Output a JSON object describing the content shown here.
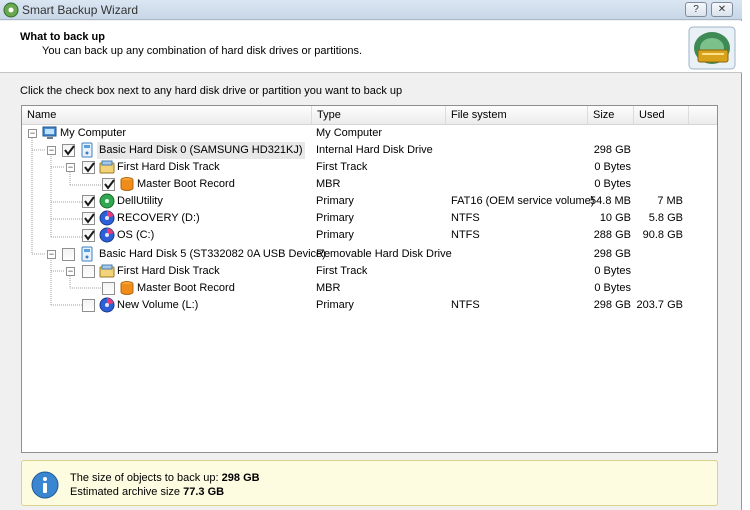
{
  "window": {
    "title": "Smart Backup Wizard",
    "help_label": "?",
    "close_label": "✕"
  },
  "header": {
    "title": "What to back up",
    "subtitle": "You can back up any combination of hard disk drives or partitions."
  },
  "instruction": "Click the check box next to any hard disk drive or partition you want to back up",
  "table": {
    "columns": [
      "Name",
      "Type",
      "File system",
      "Size",
      "Used"
    ],
    "rows": [
      {
        "name": "My Computer",
        "type": "My Computer",
        "fs": "",
        "size": "",
        "used": "",
        "checked": null,
        "icon": "computer-icon"
      },
      {
        "name": "Basic Hard Disk 0 (SAMSUNG HD321KJ)",
        "type": "Internal Hard Disk Drive",
        "fs": "",
        "size": "298 GB",
        "used": "",
        "checked": true,
        "icon": "hard-disk-icon"
      },
      {
        "name": "First Hard Disk Track",
        "type": "First Track",
        "fs": "",
        "size": "0 Bytes",
        "used": "",
        "checked": true,
        "icon": "track-icon"
      },
      {
        "name": "Master Boot Record",
        "type": "MBR",
        "fs": "",
        "size": "0 Bytes",
        "used": "",
        "checked": true,
        "icon": "mbr-icon"
      },
      {
        "name": "DellUtility",
        "type": "Primary",
        "fs": "FAT16 (OEM service volume)",
        "size": "54.8 MB",
        "used": "7 MB",
        "checked": true,
        "icon": "partition-icon"
      },
      {
        "name": "RECOVERY (D:)",
        "type": "Primary",
        "fs": "NTFS",
        "size": "10 GB",
        "used": "5.8 GB",
        "checked": true,
        "icon": "partition-icon"
      },
      {
        "name": "OS (C:)",
        "type": "Primary",
        "fs": "NTFS",
        "size": "288 GB",
        "used": "90.8 GB",
        "checked": true,
        "icon": "partition-icon"
      },
      {
        "name": "Basic Hard Disk 5 (ST332082 0A USB Device)",
        "type": "Removable Hard Disk Drive",
        "fs": "",
        "size": "298 GB",
        "used": "",
        "checked": false,
        "icon": "hard-disk-icon"
      },
      {
        "name": "First Hard Disk Track",
        "type": "First Track",
        "fs": "",
        "size": "0 Bytes",
        "used": "",
        "checked": false,
        "icon": "track-icon"
      },
      {
        "name": "Master Boot Record",
        "type": "MBR",
        "fs": "",
        "size": "0 Bytes",
        "used": "",
        "checked": false,
        "icon": "mbr-icon"
      },
      {
        "name": "New Volume (L:)",
        "type": "Primary",
        "fs": "NTFS",
        "size": "298 GB",
        "used": "203.7 GB",
        "checked": false,
        "icon": "partition-icon"
      }
    ]
  },
  "info": {
    "size_label": "The size of objects to back up:",
    "size_value": "298 GB",
    "archive_label": "Estimated archive size",
    "archive_value": "77.3 GB"
  }
}
